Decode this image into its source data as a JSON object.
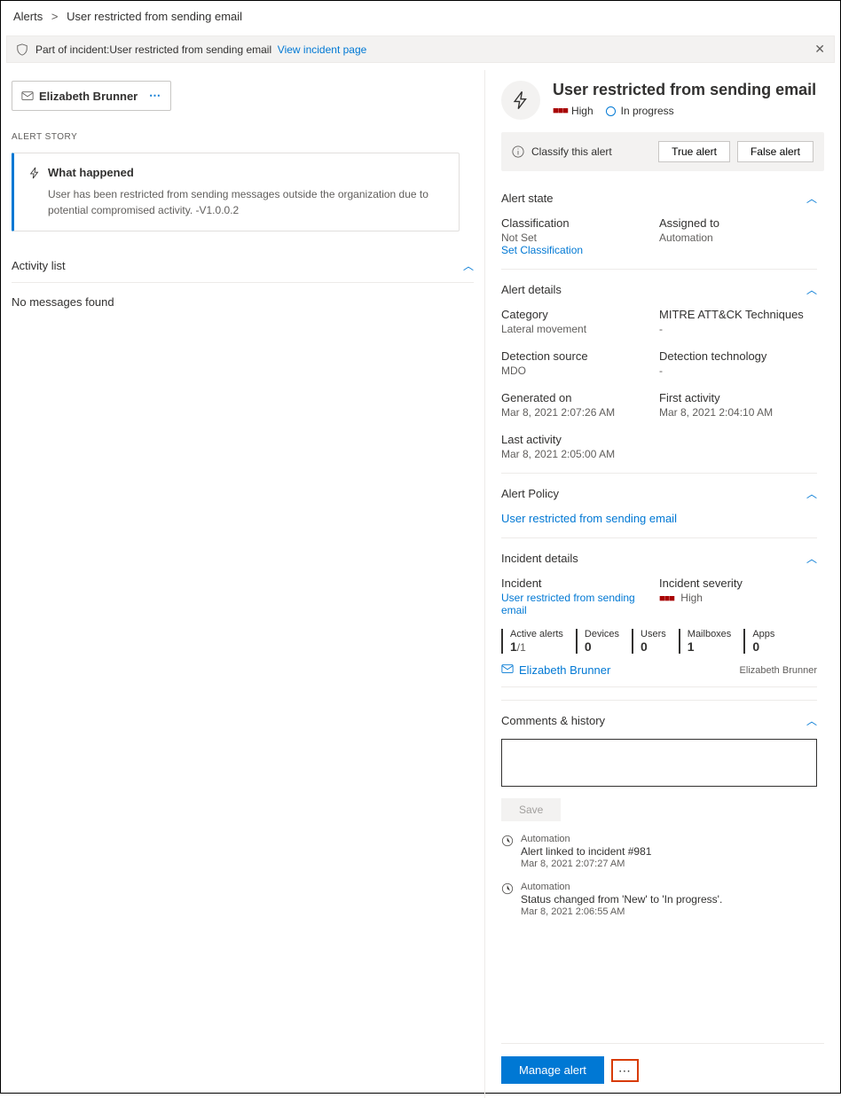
{
  "breadcrumb": {
    "root": "Alerts",
    "current": "User restricted from sending email"
  },
  "banner": {
    "prefix": "Part of incident: ",
    "incident": "User restricted from sending email",
    "view_link": "View incident page"
  },
  "user_card": {
    "name": "Elizabeth Brunner"
  },
  "left": {
    "story_label": "ALERT STORY",
    "what_happened_title": "What happened",
    "what_happened_body": "User has been restricted from sending messages outside the organization due to potential compromised activity. -V1.0.0.2",
    "activity_list_title": "Activity list",
    "activity_empty": "No messages found"
  },
  "alert": {
    "title": "User restricted from sending email",
    "severity_label": "High",
    "status_label": "In progress"
  },
  "classify": {
    "label": "Classify this alert",
    "true_btn": "True alert",
    "false_btn": "False alert"
  },
  "sections": {
    "alert_state": "Alert state",
    "alert_details": "Alert details",
    "alert_policy": "Alert Policy",
    "incident_details": "Incident details",
    "comments": "Comments & history"
  },
  "state": {
    "classification_k": "Classification",
    "classification_v": "Not Set",
    "set_classification": "Set Classification",
    "assigned_k": "Assigned to",
    "assigned_v": "Automation"
  },
  "details": {
    "category_k": "Category",
    "category_v": "Lateral movement",
    "mitre_k": "MITRE ATT&CK Techniques",
    "mitre_v": "-",
    "detsrc_k": "Detection source",
    "detsrc_v": "MDO",
    "dettech_k": "Detection technology",
    "dettech_v": "-",
    "gen_k": "Generated on",
    "gen_v": "Mar 8, 2021 2:07:26 AM",
    "first_k": "First activity",
    "first_v": "Mar 8, 2021 2:04:10 AM",
    "last_k": "Last activity",
    "last_v": "Mar 8, 2021 2:05:00 AM"
  },
  "policy_link": "User restricted from sending email",
  "incident": {
    "incident_k": "Incident",
    "incident_link": "User restricted from sending email",
    "sev_k": "Incident severity",
    "sev_v": "High",
    "stats": {
      "active_k": "Active alerts",
      "active_v": "1",
      "active_total": "/1",
      "devices_k": "Devices",
      "devices_v": "0",
      "users_k": "Users",
      "users_v": "0",
      "mail_k": "Mailboxes",
      "mail_v": "1",
      "apps_k": "Apps",
      "apps_v": "0"
    },
    "user_link": "Elizabeth Brunner",
    "user_tail": "Elizabeth Brunner"
  },
  "comments_actions": {
    "save": "Save"
  },
  "history": [
    {
      "who": "Automation",
      "text": "Alert linked to incident #981",
      "when": "Mar 8, 2021 2:07:27 AM"
    },
    {
      "who": "Automation",
      "text": "Status changed from 'New' to 'In progress'.",
      "when": "Mar 8, 2021 2:06:55 AM"
    }
  ],
  "bottom": {
    "manage": "Manage alert"
  }
}
